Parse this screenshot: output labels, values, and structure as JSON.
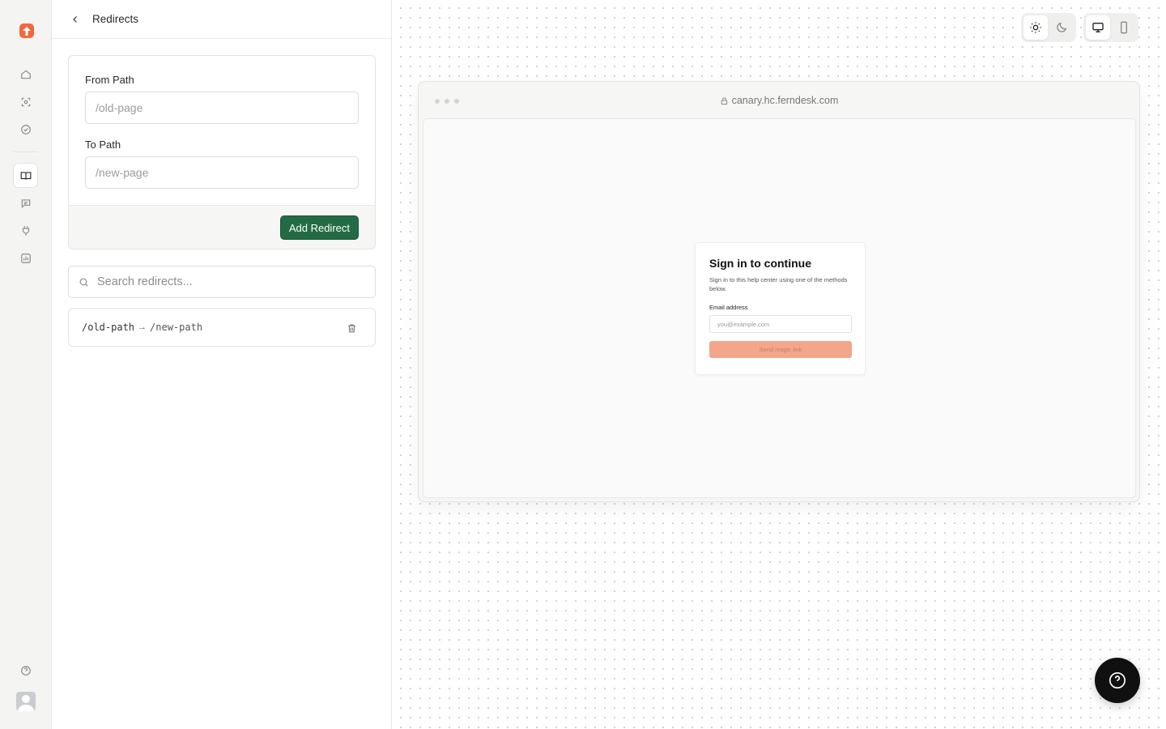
{
  "header": {
    "title": "Redirects"
  },
  "form": {
    "from_label": "From Path",
    "from_placeholder": "/old-page",
    "to_label": "To Path",
    "to_placeholder": "/new-page",
    "submit_label": "Add Redirect"
  },
  "search": {
    "placeholder": "Search redirects..."
  },
  "redirects": [
    {
      "from": "/old-path",
      "arrow": "→",
      "to": "/new-path"
    }
  ],
  "sidebar": {
    "items": [
      {
        "icon": "home-icon"
      },
      {
        "icon": "scan-icon"
      },
      {
        "icon": "check-circle-icon"
      },
      {
        "icon": "book-open-icon",
        "active": true
      },
      {
        "icon": "message-icon"
      },
      {
        "icon": "plug-icon"
      },
      {
        "icon": "chart-icon"
      }
    ],
    "bottom": [
      {
        "icon": "help-circle-icon"
      },
      {
        "icon": "user-avatar"
      }
    ]
  },
  "preview": {
    "theme_options": [
      "light",
      "dark"
    ],
    "theme_selected": "light",
    "device_options": [
      "desktop",
      "mobile"
    ],
    "device_selected": "desktop",
    "url": "canary.hc.ferndesk.com",
    "signin": {
      "title": "Sign in to continue",
      "subtitle": "Sign in to this help center using one of the methods below.",
      "email_label": "Email address",
      "email_placeholder": "you@example.com",
      "button_label": "Send magic link"
    }
  },
  "colors": {
    "brand": "#f2683c",
    "primary_button": "#236b45",
    "signin_button": "#f4a68b",
    "help_fab": "#101010"
  }
}
